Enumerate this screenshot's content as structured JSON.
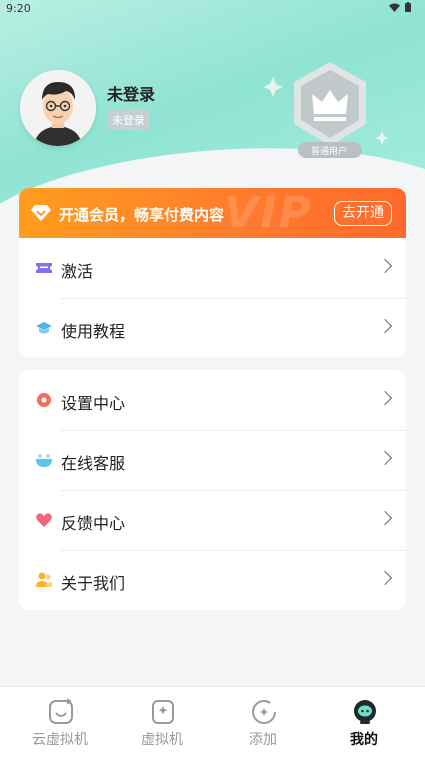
{
  "status_bar": {
    "time": "9:20",
    "icons": "wifi-icon battery-icon"
  },
  "profile": {
    "name": "未登录",
    "tag": "未登录",
    "badge_label": "普通用户"
  },
  "vip": {
    "text": "开通会员，畅享付费内容",
    "watermark": "VIP",
    "button": "去开通",
    "colors": {
      "start": "#ff9d1e",
      "end": "#ff6a2c"
    }
  },
  "card1": {
    "items": [
      {
        "label": "激活",
        "icon": "ticket-icon"
      },
      {
        "label": "使用教程",
        "icon": "graduation-cap-icon"
      }
    ]
  },
  "card2": {
    "items": [
      {
        "label": "设置中心",
        "icon": "gear-icon"
      },
      {
        "label": "在线客服",
        "icon": "customer-service-icon"
      },
      {
        "label": "反馈中心",
        "icon": "heart-icon"
      },
      {
        "label": "关于我们",
        "icon": "people-icon"
      }
    ]
  },
  "nav": {
    "items": [
      {
        "label": "云虚拟机",
        "icon": "cloud-vm-icon"
      },
      {
        "label": "虚拟机",
        "icon": "vm-icon"
      },
      {
        "label": "添加",
        "icon": "add-icon"
      },
      {
        "label": "我的",
        "icon": "profile-icon",
        "active": true
      }
    ]
  }
}
